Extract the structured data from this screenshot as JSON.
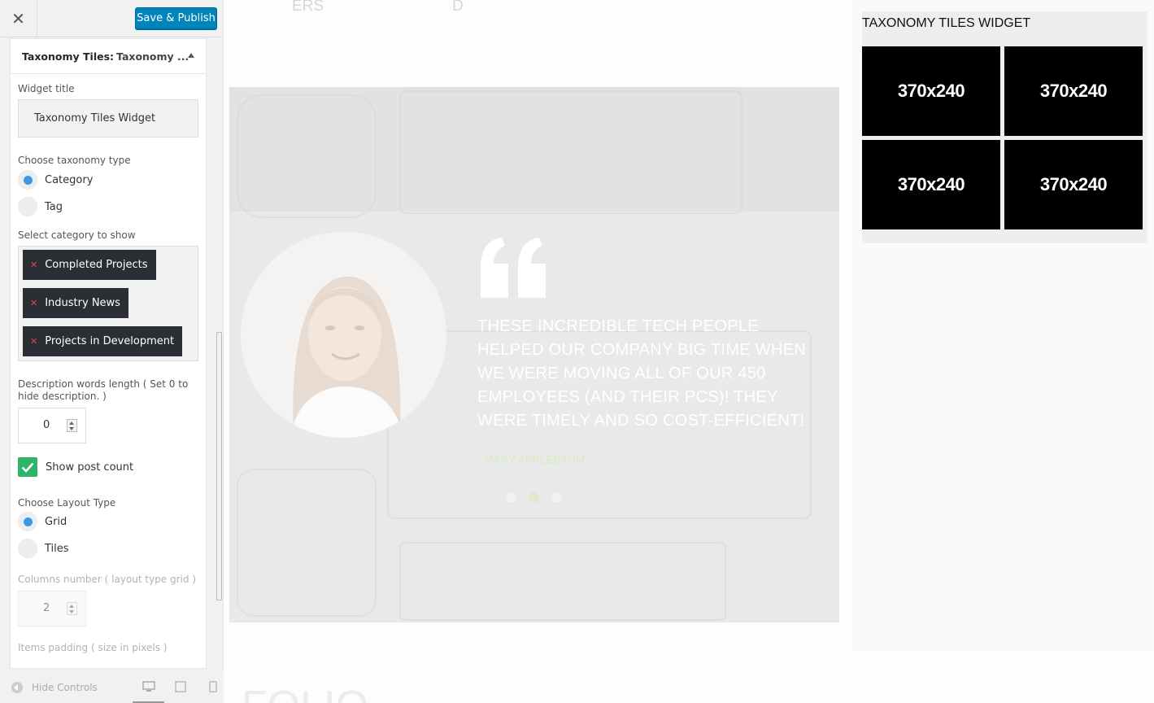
{
  "topbar": {
    "close_label": "✕",
    "publish_label": "Save & Publish"
  },
  "widget": {
    "header_title": "Taxonomy Tiles:",
    "header_sub": "Taxonomy ...",
    "title_label": "Widget title",
    "title_value": "Taxonomy Tiles Widget",
    "taxonomy_label": "Choose taxonomy type",
    "taxonomy_options": [
      "Category",
      "Tag"
    ],
    "taxonomy_selected": "Category",
    "category_label": "Select category to show",
    "selected_categories": [
      "Completed Projects",
      "Industry News",
      "Projects in Development"
    ],
    "desc_label": "Description words length ( Set 0 to hide description. )",
    "desc_value": "0",
    "post_count_label": "Show post count",
    "post_count_checked": true,
    "layout_label": "Choose Layout Type",
    "layout_options": [
      "Grid",
      "Tiles"
    ],
    "layout_selected": "Grid",
    "columns_label": "Columns number ( layout type grid )",
    "columns_value": "2",
    "padding_label": "Items padding ( size in pixels )"
  },
  "bottombar": {
    "hide_controls_label": "Hide Controls"
  },
  "preview": {
    "ghost_top_left": "ERS",
    "ghost_top_right": "D",
    "ghost_bottom": "FOLIO",
    "testimonial_quote": "THESE INCREDIBLE TECH PEOPLE HELPED OUR COMPANY BIG TIME WHEN WE WERE MOVING ALL OF OUR 450 EMPLOYEES (AND THEIR PCS)! THEY WERE TIMELY AND SO COST-EFFICIENT!",
    "testimonial_author": "- MARY APPLEBAUM",
    "tiles_widget_title": "TAXONOMY TILES WIDGET",
    "tiles": [
      "370x240",
      "370x240",
      "370x240",
      "370x240"
    ]
  },
  "colors": {
    "publish": "#0085ba",
    "chip": "#2a2f36",
    "radio_on": "#3a9ae8",
    "checkbox": "#2fb36a",
    "tile": "#000000"
  }
}
